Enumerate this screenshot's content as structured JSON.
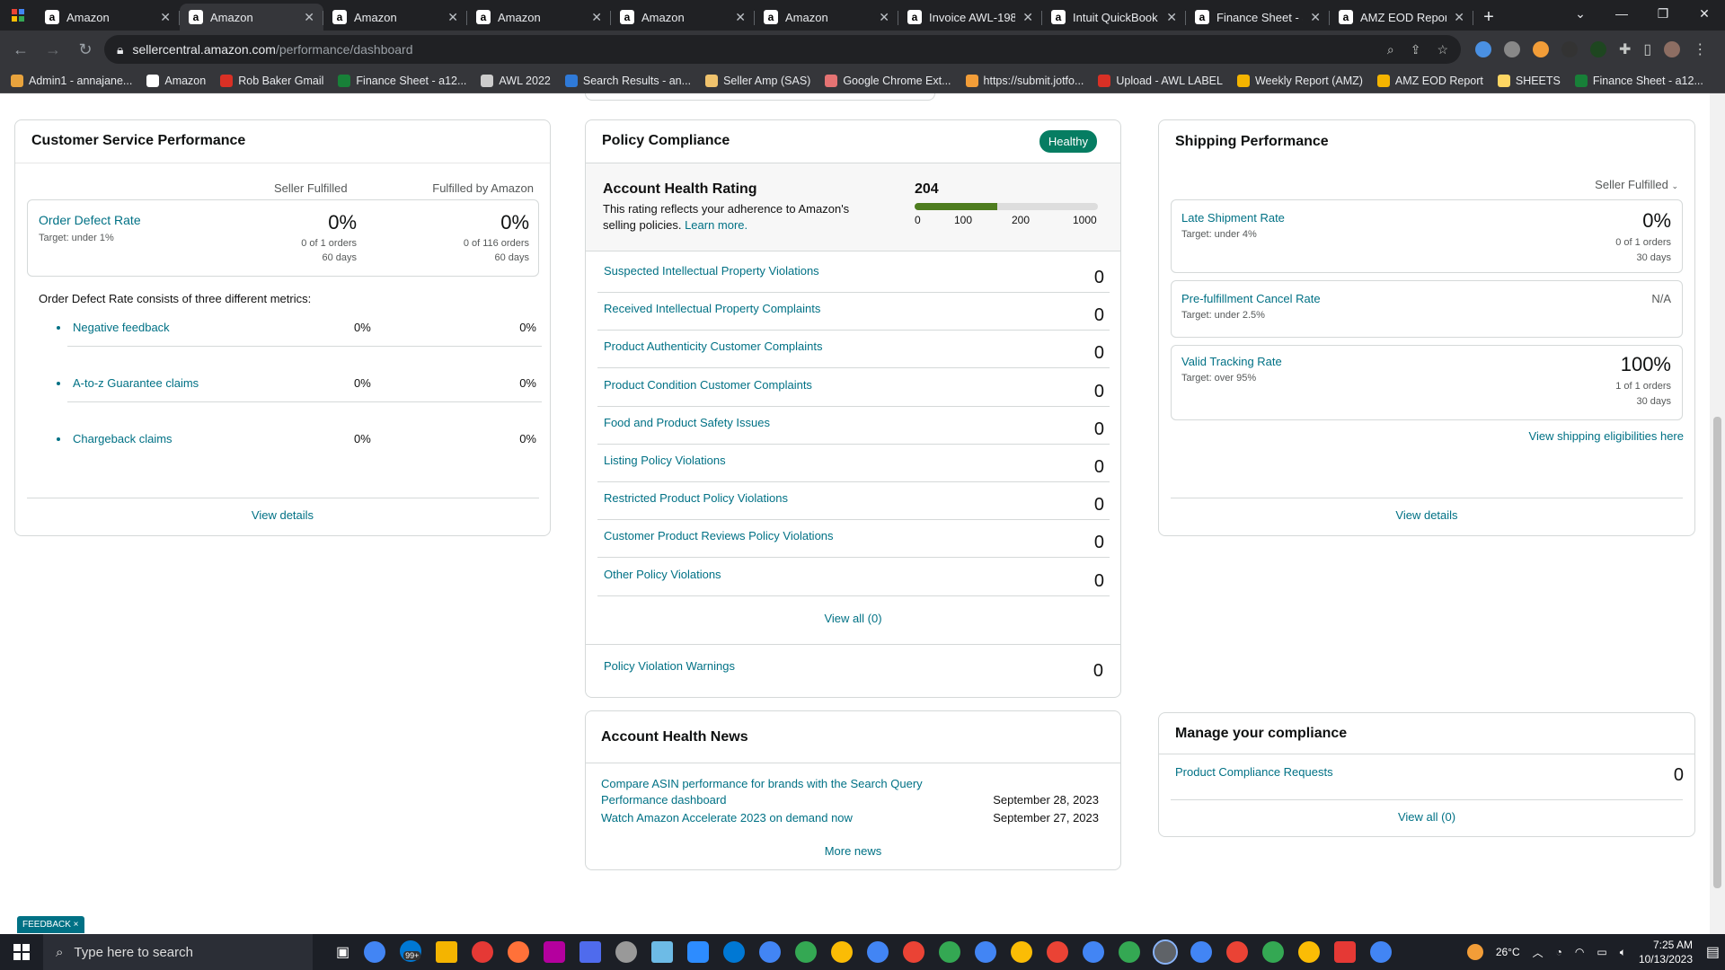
{
  "browser": {
    "tabs": [
      {
        "title": "Amazon",
        "active": false
      },
      {
        "title": "Amazon",
        "active": true
      },
      {
        "title": "Amazon",
        "active": false
      },
      {
        "title": "Amazon",
        "active": false
      },
      {
        "title": "Amazon",
        "active": false
      },
      {
        "title": "Amazon",
        "active": false
      },
      {
        "title": "Invoice AWL-198",
        "active": false
      },
      {
        "title": "Intuit QuickBook",
        "active": false
      },
      {
        "title": "Finance Sheet - a",
        "active": false
      },
      {
        "title": "AMZ EOD Report",
        "active": false
      }
    ],
    "url_host": "sellercentral.amazon.com",
    "url_path": "/performance/dashboard",
    "bookmarks": [
      {
        "label": "Admin1 - annajane...",
        "color": "#e8a33d"
      },
      {
        "label": "Amazon",
        "color": "#ffffff"
      },
      {
        "label": "Rob Baker Gmail",
        "color": "#d93025"
      },
      {
        "label": "Finance Sheet - a12...",
        "color": "#188038"
      },
      {
        "label": "AWL 2022",
        "color": "#cccccc"
      },
      {
        "label": "Search Results - an...",
        "color": "#2f7ad8"
      },
      {
        "label": "Seller Amp (SAS)",
        "color": "#f0c36d"
      },
      {
        "label": "Google Chrome Ext...",
        "color": "#e57373"
      },
      {
        "label": "https://submit.jotfo...",
        "color": "#f29d38"
      },
      {
        "label": "Upload - AWL LABEL",
        "color": "#d93025"
      },
      {
        "label": "Weekly Report (AMZ)",
        "color": "#f4b400"
      },
      {
        "label": "AMZ EOD Report",
        "color": "#f4b400"
      },
      {
        "label": "SHEETS",
        "color": "#fdd663"
      },
      {
        "label": "Finance Sheet - a12...",
        "color": "#188038"
      }
    ]
  },
  "customer_service": {
    "title": "Customer Service Performance",
    "col_seller": "Seller Fulfilled",
    "col_fba": "Fulfilled by Amazon",
    "odr_label": "Order Defect Rate",
    "odr_target": "Target: under 1%",
    "odr_seller_value": "0%",
    "odr_seller_orders": "0 of 1 orders",
    "odr_seller_days": "60 days",
    "odr_fba_value": "0%",
    "odr_fba_orders": "0 of 116 orders",
    "odr_fba_days": "60 days",
    "consists_text": "Order Defect Rate consists of three different metrics:",
    "metrics": [
      {
        "label": "Negative feedback",
        "seller": "0%",
        "fba": "0%"
      },
      {
        "label": "A-to-z Guarantee claims",
        "seller": "0%",
        "fba": "0%"
      },
      {
        "label": "Chargeback claims",
        "seller": "0%",
        "fba": "0%"
      }
    ],
    "view_details": "View details"
  },
  "policy_compliance": {
    "title": "Policy Compliance",
    "status": "Healthy",
    "ahr_title": "Account Health Rating",
    "ahr_desc": "This rating reflects your adherence to Amazon's selling policies.",
    "ahr_learn": "Learn more.",
    "ahr_score": "204",
    "ahr_score_fraction": 0.204,
    "scale_labels": [
      "0",
      "100",
      "200",
      "1000"
    ],
    "rows": [
      {
        "label": "Suspected Intellectual Property Violations",
        "value": "0"
      },
      {
        "label": "Received Intellectual Property Complaints",
        "value": "0"
      },
      {
        "label": "Product Authenticity Customer Complaints",
        "value": "0"
      },
      {
        "label": "Product Condition Customer Complaints",
        "value": "0"
      },
      {
        "label": "Food and Product Safety Issues",
        "value": "0"
      },
      {
        "label": "Listing Policy Violations",
        "value": "0"
      },
      {
        "label": "Restricted Product Policy Violations",
        "value": "0"
      },
      {
        "label": "Customer Product Reviews Policy Violations",
        "value": "0"
      },
      {
        "label": "Other Policy Violations",
        "value": "0"
      }
    ],
    "view_all": "View all (0)",
    "warnings_label": "Policy Violation Warnings",
    "warnings_value": "0"
  },
  "news": {
    "title": "Account Health News",
    "items": [
      {
        "text": "Compare ASIN performance for brands with the Search Query Performance dashboard",
        "date": "September 28, 2023"
      },
      {
        "text": "Watch Amazon Accelerate 2023 on demand now",
        "date": "September 27, 2023"
      }
    ],
    "more": "More news"
  },
  "shipping": {
    "title": "Shipping Performance",
    "filter": "Seller Fulfilled",
    "late_label": "Late Shipment Rate",
    "late_target": "Target: under 4%",
    "late_value": "0%",
    "late_orders": "0 of 1 orders",
    "late_days": "30 days",
    "cancel_label": "Pre-fulfillment Cancel Rate",
    "cancel_target": "Target: under 2.5%",
    "cancel_value": "N/A",
    "vtr_label": "Valid Tracking Rate",
    "vtr_target": "Target: over 95%",
    "vtr_value": "100%",
    "vtr_orders": "1 of 1 orders",
    "vtr_days": "30 days",
    "eligibility_link": "View shipping eligibilities here",
    "view_details": "View details"
  },
  "manage": {
    "title": "Manage your compliance",
    "row_label": "Product Compliance Requests",
    "row_value": "0",
    "view_all": "View all (0)"
  },
  "feedback": "FEEDBACK ×",
  "taskbar": {
    "search_placeholder": "Type here to search",
    "weather": "26°C",
    "time": "7:25 AM",
    "date": "10/13/2023",
    "mail_badge": "99+"
  }
}
